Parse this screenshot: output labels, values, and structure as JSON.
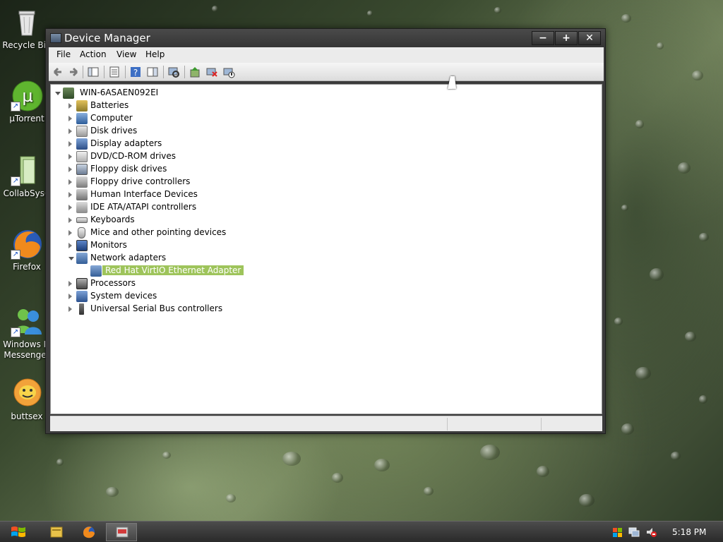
{
  "desktop": {
    "icons": [
      {
        "label": "Recycle Bin"
      },
      {
        "label": "µTorrent"
      },
      {
        "label": "CollabSysC"
      },
      {
        "label": "Firefox"
      },
      {
        "label": "Windows Li Messenger"
      },
      {
        "label": "buttsex"
      }
    ]
  },
  "window": {
    "title": "Device Manager",
    "controls": {
      "minimize": "−",
      "maximize": "+",
      "close": "✕"
    },
    "menu": [
      "File",
      "Action",
      "View",
      "Help"
    ],
    "tree": {
      "root": "WIN-6ASAEN092EI",
      "items": [
        "Batteries",
        "Computer",
        "Disk drives",
        "Display adapters",
        "DVD/CD-ROM drives",
        "Floppy disk drives",
        "Floppy drive controllers",
        "Human Interface Devices",
        "IDE ATA/ATAPI controllers",
        "Keyboards",
        "Mice and other pointing devices",
        "Monitors",
        "Network adapters",
        "Red Hat VirtIO Ethernet Adapter",
        "Processors",
        "System devices",
        "Universal Serial Bus controllers"
      ]
    }
  },
  "taskbar": {
    "clock": "5:18 PM"
  },
  "colors": {
    "selection": "#9ec45b",
    "title_bar": "#3b3b3b"
  }
}
